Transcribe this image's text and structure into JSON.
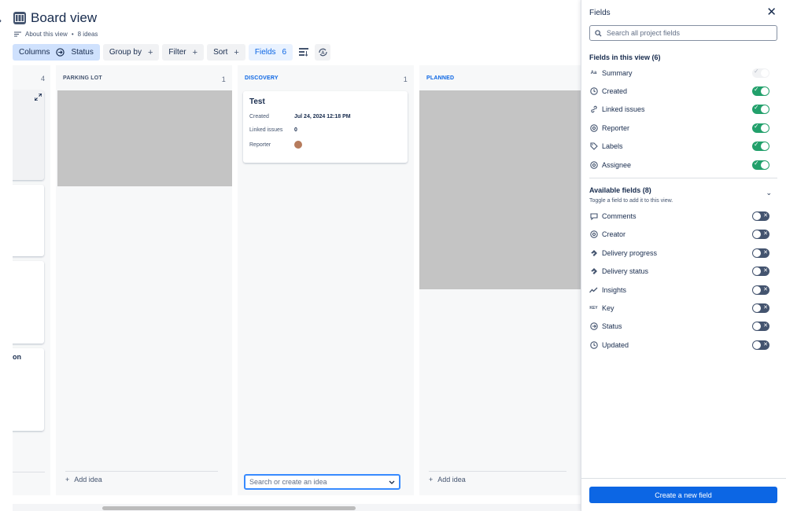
{
  "header": {
    "title": "Board view",
    "about": "About this view",
    "separator": "•",
    "idea_count": "8 ideas"
  },
  "toolbar": {
    "columns_label": "Columns",
    "columns_value": "Status",
    "group_by_label": "Group by",
    "filter_label": "Filter",
    "sort_label": "Sort",
    "fields_label": "Fields",
    "fields_count": "6",
    "plus": "+"
  },
  "board": {
    "columns": [
      {
        "name": "",
        "count": "4",
        "partial_text": "on"
      },
      {
        "name": "PARKING LOT",
        "count": "1",
        "add_label": "Add idea"
      },
      {
        "name": "DISCOVERY",
        "count": "1"
      },
      {
        "name": "PLANNED",
        "count": "",
        "add_label": "Add idea"
      }
    ],
    "card": {
      "title": "Test",
      "rows": [
        {
          "label": "Created",
          "value": "Jul 24, 2024 12:18 PM"
        },
        {
          "label": "Linked issues",
          "value": "0"
        },
        {
          "label": "Reporter",
          "value": ""
        }
      ]
    },
    "search_placeholder": "Search or create an idea"
  },
  "panel": {
    "title": "Fields",
    "search_placeholder": "Search all project fields",
    "in_view_heading": "Fields in this view (6)",
    "in_view_fields": [
      {
        "label": "Summary",
        "icon": "text-format-icon",
        "state": "disabled"
      },
      {
        "label": "Created",
        "icon": "clock-icon",
        "state": "on"
      },
      {
        "label": "Linked issues",
        "icon": "link-icon",
        "state": "on"
      },
      {
        "label": "Reporter",
        "icon": "at-icon",
        "state": "on"
      },
      {
        "label": "Labels",
        "icon": "tag-icon",
        "state": "on"
      },
      {
        "label": "Assignee",
        "icon": "at-icon",
        "state": "on"
      }
    ],
    "available_heading": "Available fields (8)",
    "available_sub": "Toggle a field to add it to this view.",
    "available_fields": [
      {
        "label": "Comments",
        "icon": "comment-icon",
        "state": "off"
      },
      {
        "label": "Creator",
        "icon": "at-icon",
        "state": "off"
      },
      {
        "label": "Delivery progress",
        "icon": "jira-icon",
        "state": "off"
      },
      {
        "label": "Delivery status",
        "icon": "jira-icon",
        "state": "off"
      },
      {
        "label": "Insights",
        "icon": "chart-line-icon",
        "state": "off"
      },
      {
        "label": "Key",
        "icon": "key-text-icon",
        "state": "off"
      },
      {
        "label": "Status",
        "icon": "arrow-circle-icon",
        "state": "off"
      },
      {
        "label": "Updated",
        "icon": "clock-icon",
        "state": "off"
      }
    ],
    "key_icon_text": "KEY",
    "text_icon_text": "Aa",
    "create_button": "Create a new field"
  },
  "colors": {
    "accent": "#0c66e4",
    "toggle_on": "#22a06b",
    "toggle_off": "#44546f",
    "placeholder": "#c4c4c4"
  }
}
